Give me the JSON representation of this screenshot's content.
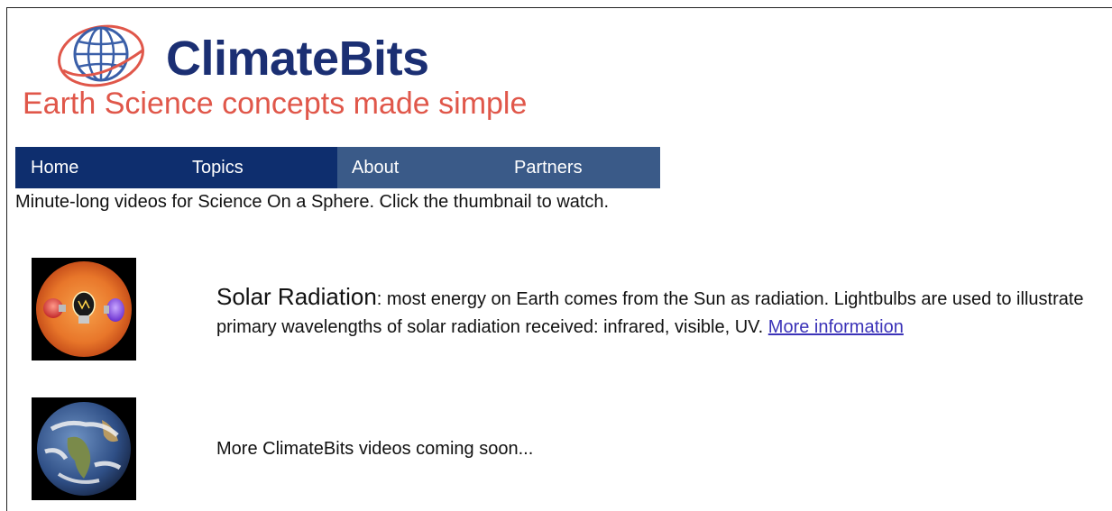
{
  "brand": {
    "name": "ClimateBits",
    "tagline": "Earth Science concepts made simple",
    "colors": {
      "name": "#1b2f73",
      "tagline": "#e0574a",
      "globe_stroke": "#3a5fa8"
    }
  },
  "nav": {
    "items": [
      {
        "label": "Home",
        "color": "#0e2e6e"
      },
      {
        "label": "Topics",
        "color": "#0e2e6e"
      },
      {
        "label": "About",
        "color": "#3a5a88"
      },
      {
        "label": "Partners",
        "color": "#3a5a88"
      }
    ]
  },
  "intro": "Minute-long videos for Science On a Sphere. Click the thumbnail to watch.",
  "videos": [
    {
      "title": "Solar Radiation",
      "description": ": most energy on Earth comes from the Sun as radiation. Lightbulbs are used to illustrate primary wavelengths of solar radiation received: infrared, visible, UV. ",
      "link_label": "More information",
      "thumbnail_icon": "sun-with-lightbulbs-thumbnail"
    }
  ],
  "coming_soon": "More ClimateBits videos coming soon...",
  "earth_thumbnail_icon": "earth-globe-thumbnail"
}
